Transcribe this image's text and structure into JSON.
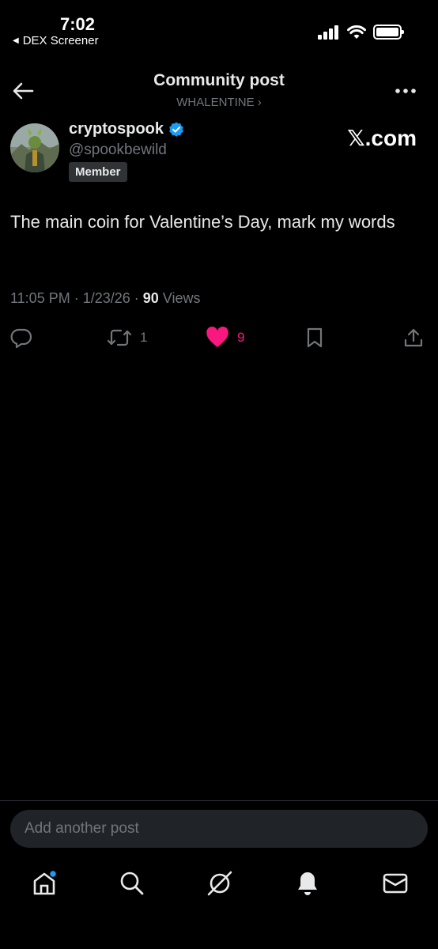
{
  "status_bar": {
    "time": "7:02",
    "back_app_label": "DEX Screener"
  },
  "header": {
    "title": "Community post",
    "community": "WHALENTINE",
    "community_chevron": "›"
  },
  "post": {
    "display_name": "cryptospook",
    "handle": "@spookbewild",
    "badge": "Member",
    "source_watermark": "𝕏.com",
    "text": "The main coin for Valentine’s Day, mark my words",
    "timestamp": "11:05 PM · 1/23/26 · ",
    "views_count": "90",
    "views_label": " Views",
    "verified_color": "#1d9bf0"
  },
  "actions": {
    "reply_icon": "reply-icon",
    "repost_count": "1",
    "like_count": "9",
    "like_color": "#f91880",
    "bookmark_icon": "bookmark-icon",
    "share_icon": "share-icon"
  },
  "reply": {
    "placeholder": "Add another post"
  },
  "bottom_nav": {
    "items": [
      "home-icon",
      "search-icon",
      "grok-icon",
      "notifications-icon",
      "messages-icon"
    ],
    "notification_dot_color": "#1d9bf0"
  }
}
